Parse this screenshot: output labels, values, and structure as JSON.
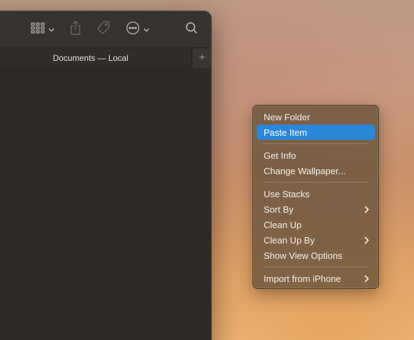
{
  "window": {
    "tab_title": "Documents — Local",
    "new_tab_label": "+"
  },
  "toolbar": {
    "icons": [
      "view-grid-icon",
      "share-icon",
      "tag-icon",
      "more-actions-icon",
      "search-icon"
    ]
  },
  "context_menu": {
    "items": [
      {
        "label": "New Folder"
      },
      {
        "label": "Paste Item",
        "highlighted": true
      },
      {
        "label": "Get Info"
      },
      {
        "label": "Change Wallpaper..."
      },
      {
        "label": "Use Stacks"
      },
      {
        "label": "Sort By",
        "submenu": true
      },
      {
        "label": "Clean Up"
      },
      {
        "label": "Clean Up By",
        "submenu": true
      },
      {
        "label": "Show View Options"
      },
      {
        "label": "Import from iPhone",
        "submenu": true
      }
    ]
  },
  "colors": {
    "highlight": "#2a87d9",
    "window_bg": "#2e2a27",
    "menu_bg": "#70583e"
  }
}
